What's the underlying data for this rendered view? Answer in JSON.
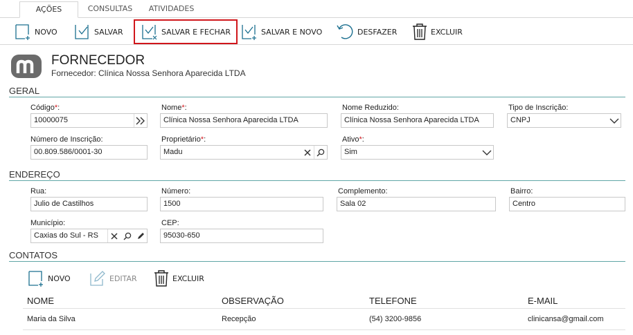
{
  "tabs": [
    {
      "label": "AÇÕES",
      "active": true
    },
    {
      "label": "CONSULTAS",
      "active": false
    },
    {
      "label": "ATIVIDADES",
      "active": false
    }
  ],
  "toolbar": {
    "novo": "NOVO",
    "salvar": "SALVAR",
    "salvar_fechar": "SALVAR E FECHAR",
    "salvar_novo": "SALVAR E NOVO",
    "desfazer": "DESFAZER",
    "excluir": "EXCLUIR"
  },
  "header": {
    "title": "FORNECEDOR",
    "subtitle": "Fornecedor: Clínica Nossa Senhora Aparecida LTDA"
  },
  "geral": {
    "section": "GERAL",
    "codigo_label": "Código",
    "codigo_value": "10000075",
    "nome_label": "Nome",
    "nome_value": "Clínica Nossa Senhora Aparecida LTDA",
    "nome_reduzido_label": "Nome Reduzido:",
    "nome_reduzido_value": "Clínica Nossa Senhora Aparecida LTDA",
    "tipo_inscricao_label": "Tipo de Inscrição:",
    "tipo_inscricao_value": "CNPJ",
    "numero_inscricao_label": "Número de Inscrição:",
    "numero_inscricao_value": "00.809.586/0001-30",
    "proprietario_label": "Proprietário",
    "proprietario_value": "Madu",
    "ativo_label": "Ativo",
    "ativo_value": "Sim"
  },
  "endereco": {
    "section": "ENDEREÇO",
    "rua_label": "Rua:",
    "rua_value": "Julio de Castilhos",
    "numero_label": "Número:",
    "numero_value": "1500",
    "complemento_label": "Complemento:",
    "complemento_value": "Sala 02",
    "bairro_label": "Bairro:",
    "bairro_value": "Centro",
    "municipio_label": "Município:",
    "municipio_value": "Caxias do Sul - RS",
    "cep_label": "CEP:",
    "cep_value": "95030-650"
  },
  "contatos": {
    "section": "CONTATOS",
    "novo": "NOVO",
    "editar": "EDITAR",
    "excluir": "EXCLUIR",
    "columns": [
      "NOME",
      "OBSERVAÇÃO",
      "TELEFONE",
      "E-MAIL"
    ],
    "rows": [
      [
        "Maria da Silva",
        "Recepção",
        "(54) 3200-9856",
        "clinicansa@gmail.com"
      ]
    ]
  },
  "required_mark": "*",
  "colon": ":",
  "colors": {
    "accent": "#2a8a8a",
    "highlight_border": "#d0161b",
    "required": "#d0161b"
  }
}
